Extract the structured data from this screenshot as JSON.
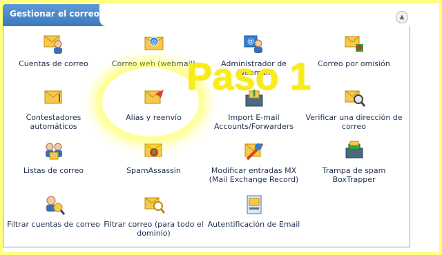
{
  "panel": {
    "title": "Gestionar el correo",
    "collapse_icon": "▲"
  },
  "overlay": {
    "step_text": "Paso 1",
    "highlight_color": "#ffff66"
  },
  "items": [
    {
      "id": "cuentas-correo",
      "label": "Cuentas de correo",
      "icon": "mail-user-icon"
    },
    {
      "id": "correo-web",
      "label": "Correo web (webmail)",
      "icon": "webmail-icon"
    },
    {
      "id": "administrador-webmail",
      "label": "Administrador de Webmail",
      "icon": "webmail-admin-icon"
    },
    {
      "id": "correo-omision",
      "label": "Correo por omisión",
      "icon": "default-mail-icon"
    },
    {
      "id": "contestadores",
      "label": "Contestadores automáticos",
      "icon": "autoresponder-icon"
    },
    {
      "id": "alias-reenvio",
      "label": "Alias y reenvío",
      "icon": "forwarder-icon"
    },
    {
      "id": "import-email",
      "label": "Import E-mail Accounts/Forwarders",
      "icon": "import-icon"
    },
    {
      "id": "verificar-direccion",
      "label": "Verificar una dirección de correo",
      "icon": "verify-address-icon"
    },
    {
      "id": "listas-correo",
      "label": "Listas de correo",
      "icon": "mailing-list-icon"
    },
    {
      "id": "spamassassin",
      "label": "SpamAssassin",
      "icon": "spamassassin-icon"
    },
    {
      "id": "modificar-mx",
      "label": "Modificar entradas MX (Mail Exchange Record)",
      "icon": "mx-entry-icon"
    },
    {
      "id": "boxtrapper",
      "label": "Trampa de spam BoxTrapper",
      "icon": "boxtrapper-icon"
    },
    {
      "id": "filtrar-cuentas",
      "label": "Filtrar cuentas de correo",
      "icon": "account-filter-icon"
    },
    {
      "id": "filtrar-dominio",
      "label": "Filtrar correo (para todo el dominio)",
      "icon": "domain-filter-icon"
    },
    {
      "id": "autentificacion",
      "label": "Autentificación de Email",
      "icon": "email-auth-icon"
    }
  ]
}
